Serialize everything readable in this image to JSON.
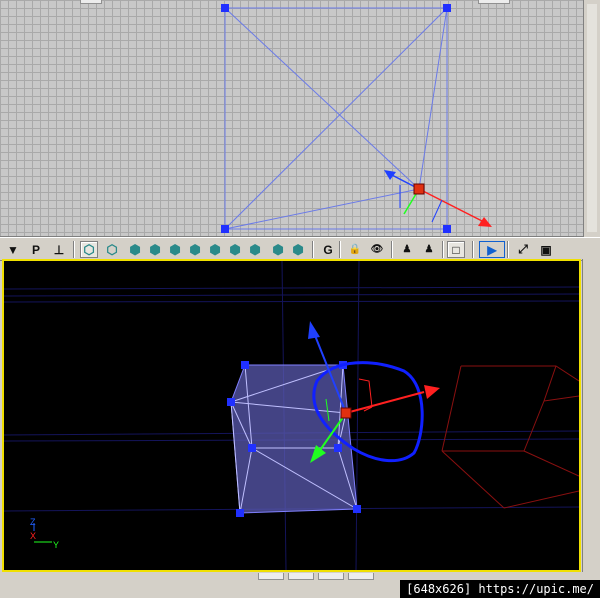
{
  "toolbar": {
    "buttons": [
      {
        "name": "collapse-arrow-icon",
        "glyph": "▼"
      },
      {
        "name": "p-button",
        "glyph": "P"
      },
      {
        "name": "actor-tool-icon",
        "glyph": "⊥"
      },
      {
        "name": "wireframe-cube-icon",
        "glyph": "⬡"
      },
      {
        "name": "cube-outline-icon",
        "glyph": "⬡"
      },
      {
        "name": "cube-teal-icon",
        "glyph": "⬢"
      },
      {
        "name": "cube-dark-teal-icon",
        "glyph": "⬢"
      },
      {
        "name": "cube-gray-icon",
        "glyph": "⬢"
      },
      {
        "name": "cube-cyan-icon",
        "glyph": "⬢"
      },
      {
        "name": "cube-green-icon",
        "glyph": "⬢"
      },
      {
        "name": "gear-cube-icon",
        "glyph": "⬢"
      },
      {
        "name": "cube-dark-icon",
        "glyph": "⬢"
      },
      {
        "name": "cube-violet-icon",
        "glyph": "⬢"
      },
      {
        "name": "cube-blue-icon",
        "glyph": "⬢"
      },
      {
        "name": "g-button",
        "glyph": "G"
      },
      {
        "name": "lock-icon",
        "glyph": "🔒"
      },
      {
        "name": "eye-icon",
        "glyph": "👁"
      },
      {
        "name": "actor-icon",
        "glyph": "♟"
      },
      {
        "name": "player-start-icon",
        "glyph": "♟"
      },
      {
        "name": "square-icon",
        "glyph": "□"
      },
      {
        "name": "play-icon",
        "glyph": "▶"
      },
      {
        "name": "maximize-arrow-icon",
        "glyph": "⤢"
      },
      {
        "name": "window-icon",
        "glyph": "▣"
      }
    ]
  },
  "axis_labels": {
    "z": "Z",
    "x": "X",
    "y": "Y"
  },
  "watermark": "[648x626] https://upic.me/",
  "colors": {
    "viewport_highlight": "#f0e000",
    "brush_blue": "#3f3fff",
    "axis_x": "#ff2020",
    "axis_y": "#20ff20",
    "axis_z": "#2040ff",
    "selected_vertex": "#ff3010"
  }
}
